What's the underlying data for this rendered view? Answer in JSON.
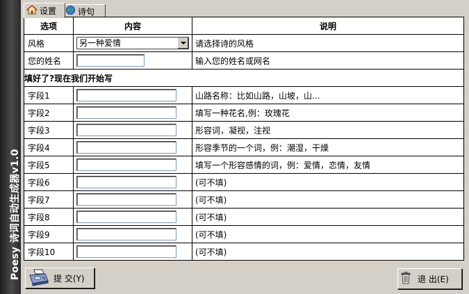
{
  "app": {
    "side_title": "Poesy 诗词自动生成器v1.0"
  },
  "tabs": [
    {
      "label": "设置",
      "icon": "home-icon"
    },
    {
      "label": "诗句",
      "icon": "globe-icon"
    }
  ],
  "table": {
    "headers": [
      "选项",
      "内容",
      "说明"
    ],
    "style_row": {
      "label": "风格",
      "value": "另一种爱情",
      "desc": "请选择诗的风格"
    },
    "name_row": {
      "label": "您的姓名",
      "value": "",
      "desc": "输入您的姓名或网名"
    },
    "section_title": "填好了?现在我们开始写",
    "fields": [
      {
        "label": "字段1",
        "value": "",
        "desc": "山路名称：比如山路，山坡，山..."
      },
      {
        "label": "字段2",
        "value": "",
        "desc": "填写一种花名,例：玫瑰花"
      },
      {
        "label": "字段3",
        "value": "",
        "desc": "形容词，凝视，注视"
      },
      {
        "label": "字段4",
        "value": "",
        "desc": "形容季节的一个词，例：潮湿，干燥"
      },
      {
        "label": "字段5",
        "value": "",
        "desc": "填写一个形容感情的词，例：爱情，恋情，友情"
      },
      {
        "label": "字段6",
        "value": "",
        "desc": "(可不填)"
      },
      {
        "label": "字段7",
        "value": "",
        "desc": "(可不填)"
      },
      {
        "label": "字段8",
        "value": "",
        "desc": "(可不填)"
      },
      {
        "label": "字段9",
        "value": "",
        "desc": "(可不填)"
      },
      {
        "label": "字段10",
        "value": "",
        "desc": "(可不填)"
      }
    ]
  },
  "buttons": {
    "submit_label": "提 交(Y)",
    "exit_label": "退 出(E)"
  }
}
